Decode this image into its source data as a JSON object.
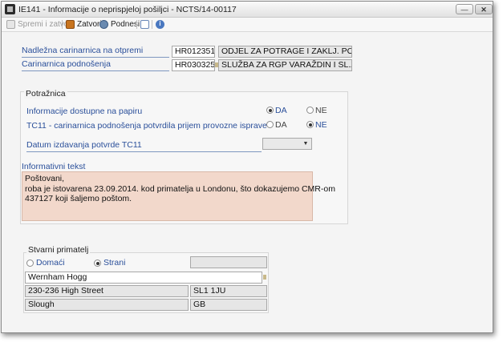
{
  "window": {
    "title": "IE141 - Informacije o neprispjeloj pošiljci - NCTS/14-00117"
  },
  "toolbar": {
    "save_close": "Spremi i zatvori",
    "close": "Zatvori",
    "submit": "Podnesi"
  },
  "header": {
    "office_dest_label": "Nadležna carinarnica na otpremi",
    "office_dest_code": "HR012351",
    "office_dest_name": "ODJEL ZA POTRAGE I ZAKLJ. POSTU",
    "office_dep_label": "Carinarnica podnošenja",
    "office_dep_code": "HR030325",
    "office_dep_name": "SLUŽBA ZA RGP VARAŽDIN I SL.ZON"
  },
  "potraznica": {
    "title": "Potražnica",
    "paper_label": "Informacije dostupne na papiru",
    "paper_yes": "DA",
    "paper_no": "NE",
    "paper_selected": "DA",
    "tc11_label": "TC11 - carinarnica podnošenja potvrdila prijem provozne isprave",
    "tc11_yes": "DA",
    "tc11_no": "NE",
    "tc11_selected": "NE",
    "date_label": "Datum izdavanja potvrde TC11",
    "date_value": "",
    "info_label": "Informativni tekst",
    "info_lines": [
      "Poštovani,",
      "roba je istovarena 23.09.2014. kod primatelja u Londonu, što dokazujemo CMR-om",
      "437127 koji šaljemo poštom."
    ]
  },
  "recipient": {
    "title": "Stvarni primatelj",
    "domestic": "Domaći",
    "foreign": "Strani",
    "selected": "Strani",
    "id_value": "",
    "name": "Wernham Hogg",
    "street": "230-236 High Street",
    "postcode": "SL1 1JU",
    "city": "Slough",
    "country": "GB"
  }
}
